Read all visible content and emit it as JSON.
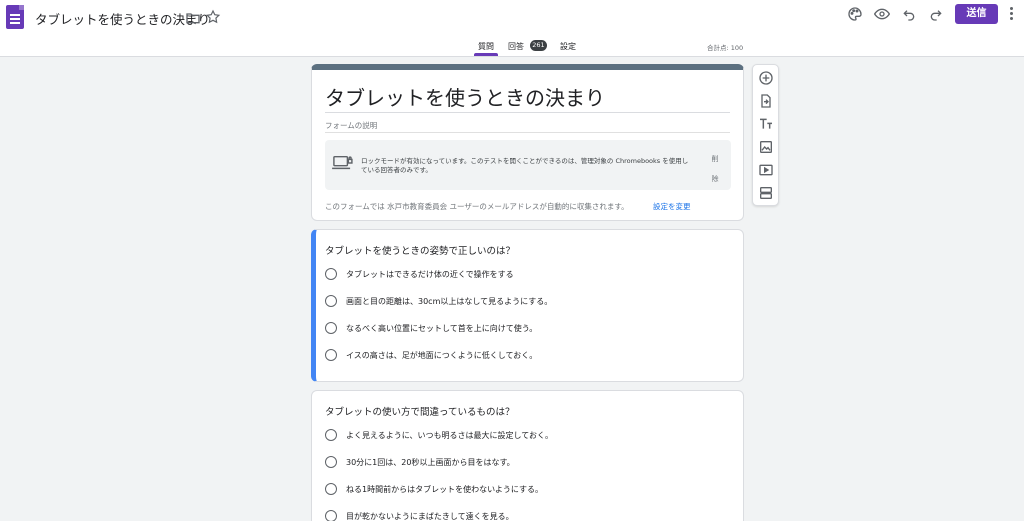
{
  "header": {
    "doc_title": "タブレットを使うときの決まり",
    "send_label": "送信",
    "icons": [
      "forms-app-icon",
      "folder-icon",
      "star-icon",
      "palette-icon",
      "preview-eye-icon",
      "undo-icon",
      "redo-icon",
      "more-vert-icon"
    ]
  },
  "tabs": {
    "questions": "質問",
    "responses": "回答",
    "responses_count": "261",
    "settings": "設定",
    "total_points": "合計点: 100"
  },
  "form": {
    "title": "タブレットを使うときの決まり",
    "description_placeholder": "フォームの説明",
    "lock_mode_text": "ロックモードが有効になっています。このテストを開くことができるのは、管理対象の Chromebooks を使用している回答者のみです。",
    "lock_delete": "削除",
    "collect_text": "このフォームでは 水戸市教育委員会 ユーザーのメールアドレスが自動的に収集されます。",
    "collect_link": "設定を変更"
  },
  "questions": [
    {
      "title": "タブレットを使うときの姿勢で正しいのは？",
      "options": [
        "タブレットはできるだけ体の近くで操作をする",
        "画面と目の距離は、30cm以上はなして見るようにする。",
        "なるべく高い位置にセットして首を上に向けて使う。",
        "イスの高さは、足が地面につくように低くしておく。"
      ]
    },
    {
      "title": "タブレットの使い方で間違っているものは？",
      "options": [
        "よく見えるように、いつも明るさは最大に設定しておく。",
        "30分に1回は、20秒以上画面から目をはなす。",
        "ねる1時間前からはタブレットを使わないようにする。",
        "目が乾かないようにまばたきして遠くを見る。"
      ]
    }
  ],
  "toolbar": [
    "add-question-icon",
    "import-questions-icon",
    "add-title-icon",
    "add-image-icon",
    "add-video-icon",
    "add-section-icon"
  ],
  "colors": {
    "accent": "#673ab7",
    "active_border": "#4285f4",
    "link": "#1a73e8"
  }
}
